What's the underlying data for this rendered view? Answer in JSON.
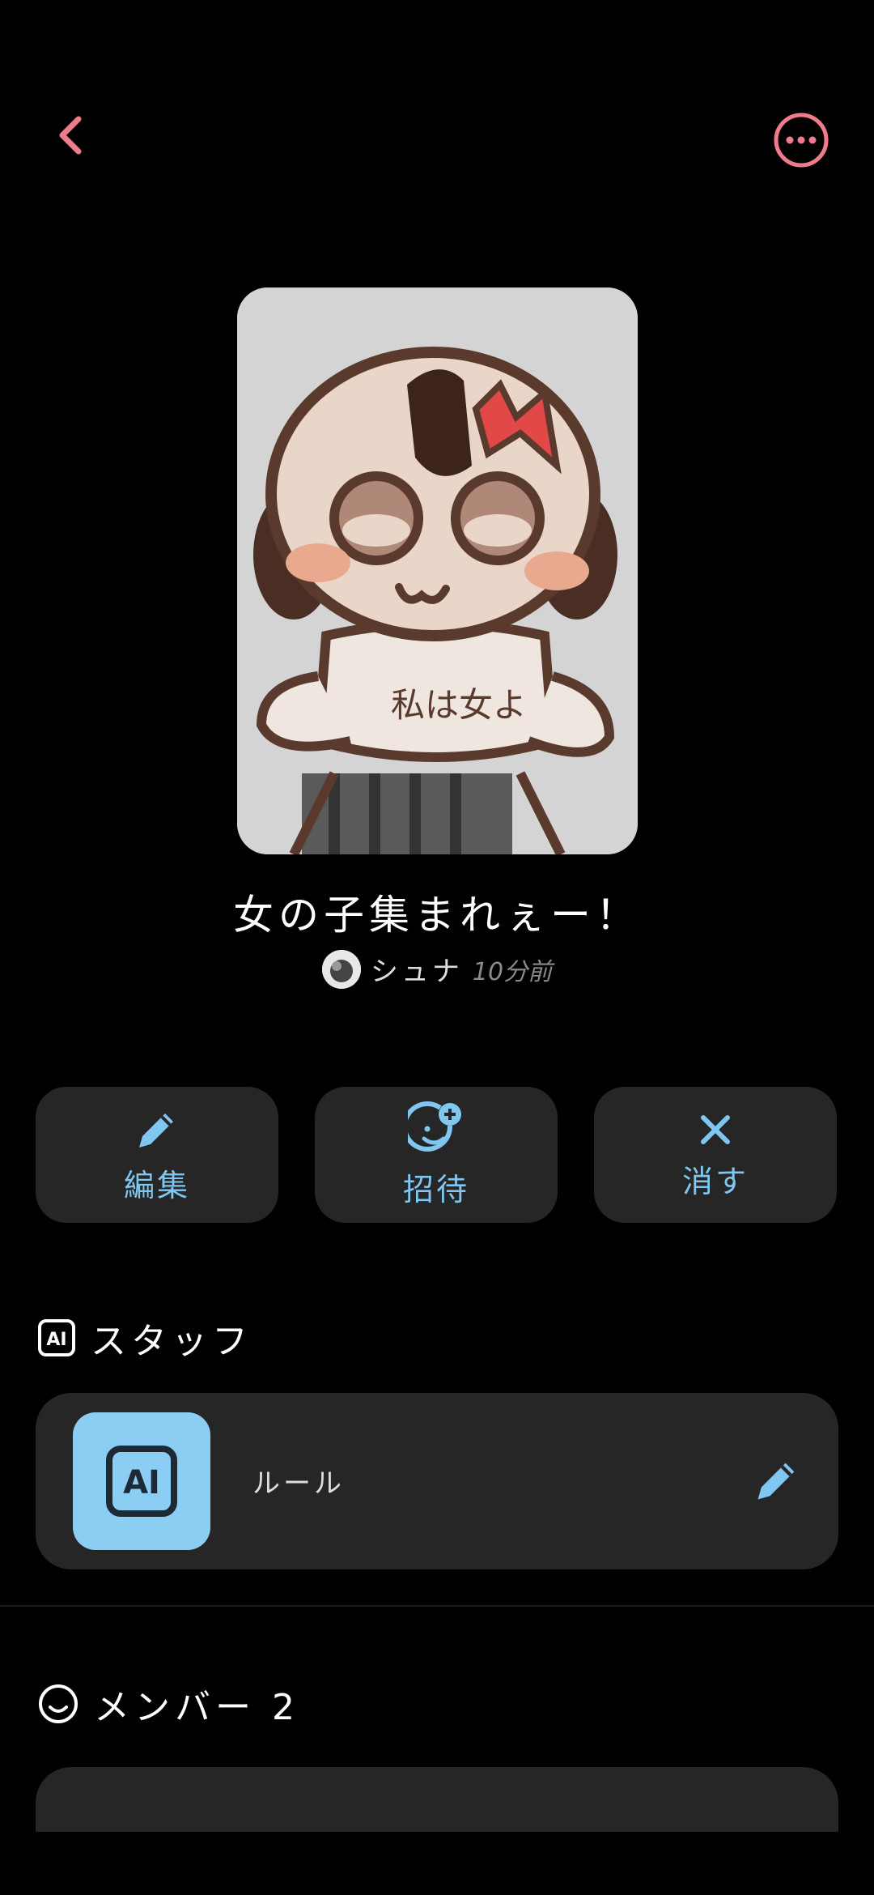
{
  "header": {
    "back_icon": "chevron-left-icon",
    "more_icon": "more-horizontal-icon",
    "accent": "#f07b8c"
  },
  "chat": {
    "title": "女の子集まれぇー！",
    "author": "シュナ",
    "time": "10分前",
    "cover_text": "私は女よ"
  },
  "actions": [
    {
      "label": "編集",
      "icon": "pencil-icon"
    },
    {
      "label": "招待",
      "icon": "invite-face-plus-icon"
    },
    {
      "label": "消す",
      "icon": "close-icon"
    }
  ],
  "staff": {
    "header": "スタッフ",
    "header_icon": "ai-badge-icon",
    "item": {
      "name": "ルール",
      "avatar_text": "AI"
    }
  },
  "members": {
    "header": "メンバー 2",
    "header_icon": "face-icon"
  },
  "colors": {
    "action_text": "#7fc6f0",
    "ai_tile": "#8ccdf3",
    "card_bg": "#262626"
  }
}
